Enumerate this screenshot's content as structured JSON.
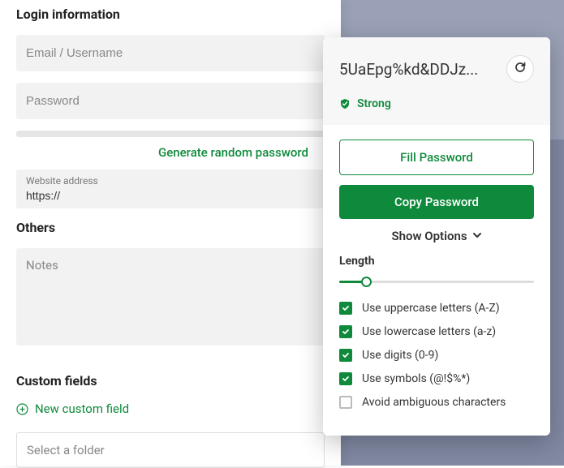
{
  "left": {
    "login_section": "Login information",
    "email_placeholder": "Email / Username",
    "password_placeholder": "Password",
    "generate_link": "Generate random password",
    "website_label": "Website address",
    "website_value": "https://",
    "others_section": "Others",
    "notes_placeholder": "Notes",
    "custom_section": "Custom fields",
    "new_field_link": "New custom field",
    "folder_placeholder": "Select a folder"
  },
  "popup": {
    "password_preview": "5UaEpg%kd&DDJz...",
    "strength": "Strong",
    "fill_btn": "Fill Password",
    "copy_btn": "Copy Password",
    "show_options": "Show Options",
    "length_label": "Length",
    "options": [
      {
        "label": "Use uppercase letters (A-Z)",
        "checked": true
      },
      {
        "label": "Use lowercase letters (a-z)",
        "checked": true
      },
      {
        "label": "Use digits (0-9)",
        "checked": true
      },
      {
        "label": "Use symbols (@!$%*)",
        "checked": true
      },
      {
        "label": "Avoid ambiguous characters",
        "checked": false
      }
    ]
  }
}
